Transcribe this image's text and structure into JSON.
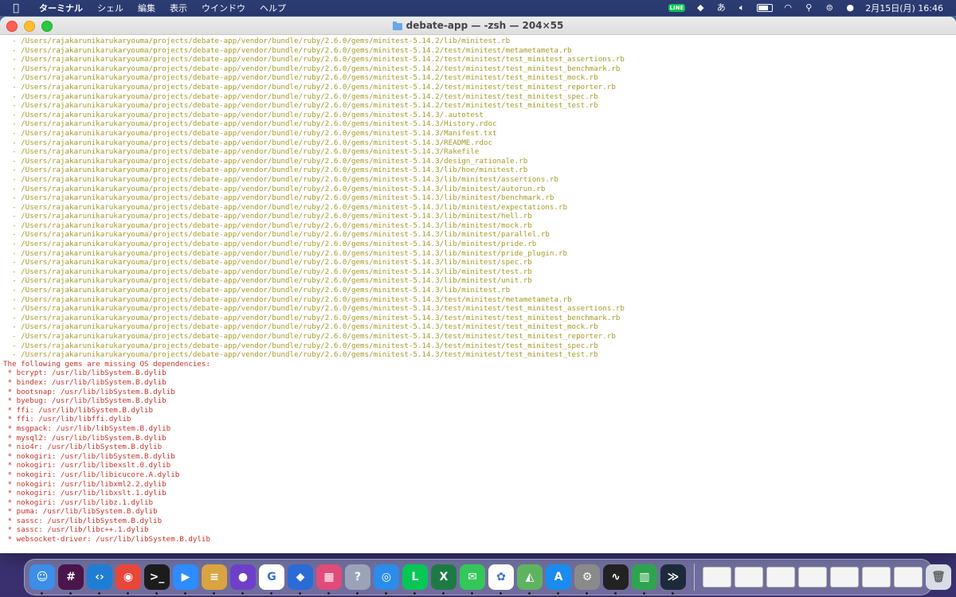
{
  "menubar": {
    "app_name": "ターミナル",
    "items": [
      "シェル",
      "編集",
      "表示",
      "ウインドウ",
      "ヘルプ"
    ],
    "line_badge": "LINE",
    "ime": "あ",
    "datetime": "2月15日(月)  16:46"
  },
  "window": {
    "title": "debate-app — -zsh — 204×55"
  },
  "terminal": {
    "path_lines": [
      "  - /Users/rajakarunikarukaryouma/projects/debate-app/vendor/bundle/ruby/2.6.0/gems/minitest-5.14.2/lib/minitest.rb",
      "  - /Users/rajakarunikarukaryouma/projects/debate-app/vendor/bundle/ruby/2.6.0/gems/minitest-5.14.2/test/minitest/metametameta.rb",
      "  - /Users/rajakarunikarukaryouma/projects/debate-app/vendor/bundle/ruby/2.6.0/gems/minitest-5.14.2/test/minitest/test_minitest_assertions.rb",
      "  - /Users/rajakarunikarukaryouma/projects/debate-app/vendor/bundle/ruby/2.6.0/gems/minitest-5.14.2/test/minitest/test_minitest_benchmark.rb",
      "  - /Users/rajakarunikarukaryouma/projects/debate-app/vendor/bundle/ruby/2.6.0/gems/minitest-5.14.2/test/minitest/test_minitest_mock.rb",
      "  - /Users/rajakarunikarukaryouma/projects/debate-app/vendor/bundle/ruby/2.6.0/gems/minitest-5.14.2/test/minitest/test_minitest_reporter.rb",
      "  - /Users/rajakarunikarukaryouma/projects/debate-app/vendor/bundle/ruby/2.6.0/gems/minitest-5.14.2/test/minitest/test_minitest_spec.rb",
      "  - /Users/rajakarunikarukaryouma/projects/debate-app/vendor/bundle/ruby/2.6.0/gems/minitest-5.14.2/test/minitest/test_minitest_test.rb",
      "  - /Users/rajakarunikarukaryouma/projects/debate-app/vendor/bundle/ruby/2.6.0/gems/minitest-5.14.3/.autotest",
      "  - /Users/rajakarunikarukaryouma/projects/debate-app/vendor/bundle/ruby/2.6.0/gems/minitest-5.14.3/History.rdoc",
      "  - /Users/rajakarunikarukaryouma/projects/debate-app/vendor/bundle/ruby/2.6.0/gems/minitest-5.14.3/Manifest.txt",
      "  - /Users/rajakarunikarukaryouma/projects/debate-app/vendor/bundle/ruby/2.6.0/gems/minitest-5.14.3/README.rdoc",
      "  - /Users/rajakarunikarukaryouma/projects/debate-app/vendor/bundle/ruby/2.6.0/gems/minitest-5.14.3/Rakefile",
      "  - /Users/rajakarunikarukaryouma/projects/debate-app/vendor/bundle/ruby/2.6.0/gems/minitest-5.14.3/design_rationale.rb",
      "  - /Users/rajakarunikarukaryouma/projects/debate-app/vendor/bundle/ruby/2.6.0/gems/minitest-5.14.3/lib/hoe/minitest.rb",
      "  - /Users/rajakarunikarukaryouma/projects/debate-app/vendor/bundle/ruby/2.6.0/gems/minitest-5.14.3/lib/minitest/assertions.rb",
      "  - /Users/rajakarunikarukaryouma/projects/debate-app/vendor/bundle/ruby/2.6.0/gems/minitest-5.14.3/lib/minitest/autorun.rb",
      "  - /Users/rajakarunikarukaryouma/projects/debate-app/vendor/bundle/ruby/2.6.0/gems/minitest-5.14.3/lib/minitest/benchmark.rb",
      "  - /Users/rajakarunikarukaryouma/projects/debate-app/vendor/bundle/ruby/2.6.0/gems/minitest-5.14.3/lib/minitest/expectations.rb",
      "  - /Users/rajakarunikarukaryouma/projects/debate-app/vendor/bundle/ruby/2.6.0/gems/minitest-5.14.3/lib/minitest/hell.rb",
      "  - /Users/rajakarunikarukaryouma/projects/debate-app/vendor/bundle/ruby/2.6.0/gems/minitest-5.14.3/lib/minitest/mock.rb",
      "  - /Users/rajakarunikarukaryouma/projects/debate-app/vendor/bundle/ruby/2.6.0/gems/minitest-5.14.3/lib/minitest/parallel.rb",
      "  - /Users/rajakarunikarukaryouma/projects/debate-app/vendor/bundle/ruby/2.6.0/gems/minitest-5.14.3/lib/minitest/pride.rb",
      "  - /Users/rajakarunikarukaryouma/projects/debate-app/vendor/bundle/ruby/2.6.0/gems/minitest-5.14.3/lib/minitest/pride_plugin.rb",
      "  - /Users/rajakarunikarukaryouma/projects/debate-app/vendor/bundle/ruby/2.6.0/gems/minitest-5.14.3/lib/minitest/spec.rb",
      "  - /Users/rajakarunikarukaryouma/projects/debate-app/vendor/bundle/ruby/2.6.0/gems/minitest-5.14.3/lib/minitest/test.rb",
      "  - /Users/rajakarunikarukaryouma/projects/debate-app/vendor/bundle/ruby/2.6.0/gems/minitest-5.14.3/lib/minitest/unit.rb",
      "  - /Users/rajakarunikarukaryouma/projects/debate-app/vendor/bundle/ruby/2.6.0/gems/minitest-5.14.3/lib/minitest.rb",
      "  - /Users/rajakarunikarukaryouma/projects/debate-app/vendor/bundle/ruby/2.6.0/gems/minitest-5.14.3/test/minitest/metametameta.rb",
      "  - /Users/rajakarunikarukaryouma/projects/debate-app/vendor/bundle/ruby/2.6.0/gems/minitest-5.14.3/test/minitest/test_minitest_assertions.rb",
      "  - /Users/rajakarunikarukaryouma/projects/debate-app/vendor/bundle/ruby/2.6.0/gems/minitest-5.14.3/test/minitest/test_minitest_benchmark.rb",
      "  - /Users/rajakarunikarukaryouma/projects/debate-app/vendor/bundle/ruby/2.6.0/gems/minitest-5.14.3/test/minitest/test_minitest_mock.rb",
      "  - /Users/rajakarunikarukaryouma/projects/debate-app/vendor/bundle/ruby/2.6.0/gems/minitest-5.14.3/test/minitest/test_minitest_reporter.rb",
      "  - /Users/rajakarunikarukaryouma/projects/debate-app/vendor/bundle/ruby/2.6.0/gems/minitest-5.14.3/test/minitest/test_minitest_spec.rb",
      "  - /Users/rajakarunikarukaryouma/projects/debate-app/vendor/bundle/ruby/2.6.0/gems/minitest-5.14.3/test/minitest/test_minitest_test.rb"
    ],
    "error_header": "The following gems are missing OS dependencies:",
    "dependency_lines": [
      " * bcrypt: /usr/lib/libSystem.B.dylib",
      " * bindex: /usr/lib/libSystem.B.dylib",
      " * bootsnap: /usr/lib/libSystem.B.dylib",
      " * byebug: /usr/lib/libSystem.B.dylib",
      " * ffi: /usr/lib/libSystem.B.dylib",
      " * ffi: /usr/lib/libffi.dylib",
      " * msgpack: /usr/lib/libSystem.B.dylib",
      " * mysql2: /usr/lib/libSystem.B.dylib",
      " * nio4r: /usr/lib/libSystem.B.dylib",
      " * nokogiri: /usr/lib/libSystem.B.dylib",
      " * nokogiri: /usr/lib/libexslt.0.dylib",
      " * nokogiri: /usr/lib/libicucore.A.dylib",
      " * nokogiri: /usr/lib/libxml2.2.dylib",
      " * nokogiri: /usr/lib/libxslt.1.dylib",
      " * nokogiri: /usr/lib/libz.1.dylib",
      " * puma: /usr/lib/libSystem.B.dylib",
      " * sassc: /usr/lib/libSystem.B.dylib",
      " * sassc: /usr/lib/libc++.1.dylib",
      " * websocket-driver: /usr/lib/libSystem.B.dylib"
    ]
  },
  "colors": {
    "path_text": "#a89a28",
    "error_text": "#c5342c"
  },
  "dock": {
    "apps": [
      {
        "name": "finder-icon",
        "color": "#3b8fe8",
        "glyph": "☺"
      },
      {
        "name": "slack-icon",
        "color": "#4a154b",
        "glyph": "#"
      },
      {
        "name": "vscode-icon",
        "color": "#1f7ed3",
        "glyph": "‹›"
      },
      {
        "name": "chrome-icon",
        "color": "#e9463a",
        "glyph": "◉"
      },
      {
        "name": "terminal-icon",
        "color": "#1c1c1c",
        "glyph": ">_"
      },
      {
        "name": "zoom-icon",
        "color": "#2d8cff",
        "glyph": "▶"
      },
      {
        "name": "sequel-pro-icon",
        "color": "#d9a441",
        "glyph": "≡"
      },
      {
        "name": "github-desktop-icon",
        "color": "#6e40c9",
        "glyph": "●"
      },
      {
        "name": "grammarly-icon",
        "color": "#ffffff",
        "glyph": "G"
      },
      {
        "name": "screen-app-icon",
        "color": "#2b6bd6",
        "glyph": "◆"
      },
      {
        "name": "launchpad-icon",
        "color": "#e04b7a",
        "glyph": "▦"
      },
      {
        "name": "help-icon",
        "color": "#9aa3b8",
        "glyph": "?"
      },
      {
        "name": "safari-icon",
        "color": "#2b8cea",
        "glyph": "◎"
      },
      {
        "name": "line-icon",
        "color": "#06c755",
        "glyph": "L"
      },
      {
        "name": "excel-icon",
        "color": "#1e7a45",
        "glyph": "X"
      },
      {
        "name": "messages-icon",
        "color": "#34c759",
        "glyph": "✉"
      },
      {
        "name": "photos-icon",
        "color": "#ffffff",
        "glyph": "✿"
      },
      {
        "name": "maps-icon",
        "color": "#5fb35f",
        "glyph": "◭"
      },
      {
        "name": "app-store-icon",
        "color": "#1a8cf0",
        "glyph": "A"
      },
      {
        "name": "system-preferences-icon",
        "color": "#8a8a8a",
        "glyph": "⚙"
      },
      {
        "name": "activity-monitor-icon",
        "color": "#222222",
        "glyph": "∿"
      },
      {
        "name": "numbers-icon",
        "color": "#2fa44f",
        "glyph": "▥"
      },
      {
        "name": "vnc-icon",
        "color": "#1c2a3a",
        "glyph": "≫"
      }
    ],
    "thumbnails": 7
  }
}
